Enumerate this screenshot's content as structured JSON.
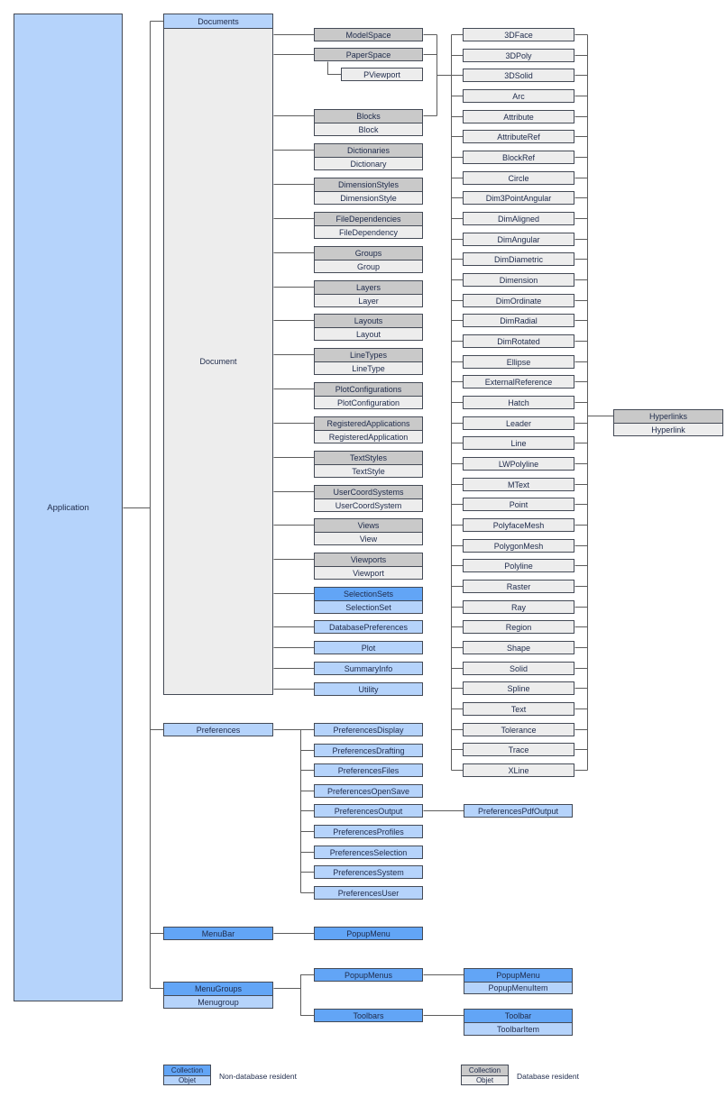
{
  "diagram": {
    "application": "Application",
    "documents": {
      "collection": "Documents",
      "object": "Document"
    },
    "model_space": "ModelSpace",
    "paper_space": "PaperSpace",
    "pviewport": "PViewport",
    "document_collections": [
      {
        "collection": "Blocks",
        "object": "Block",
        "resident": "database"
      },
      {
        "collection": "Dictionaries",
        "object": "Dictionary",
        "resident": "database"
      },
      {
        "collection": "DimensionStyles",
        "object": "DimensionStyle",
        "resident": "database"
      },
      {
        "collection": "FileDependencies",
        "object": "FileDependency",
        "resident": "database"
      },
      {
        "collection": "Groups",
        "object": "Group",
        "resident": "database"
      },
      {
        "collection": "Layers",
        "object": "Layer",
        "resident": "database"
      },
      {
        "collection": "Layouts",
        "object": "Layout",
        "resident": "database"
      },
      {
        "collection": "LineTypes",
        "object": "LineType",
        "resident": "database"
      },
      {
        "collection": "PlotConfigurations",
        "object": "PlotConfiguration",
        "resident": "database"
      },
      {
        "collection": "RegisteredApplications",
        "object": "RegisteredApplication",
        "resident": "database"
      },
      {
        "collection": "TextStyles",
        "object": "TextStyle",
        "resident": "database"
      },
      {
        "collection": "UserCoordSystems",
        "object": "UserCoordSystem",
        "resident": "database"
      },
      {
        "collection": "Views",
        "object": "View",
        "resident": "database"
      },
      {
        "collection": "Viewports",
        "object": "Viewport",
        "resident": "database"
      },
      {
        "collection": "SelectionSets",
        "object": "SelectionSet",
        "resident": "non-database"
      }
    ],
    "document_objects": [
      "DatabasePreferences",
      "Plot",
      "SummaryInfo",
      "Utility"
    ],
    "entities": [
      "3DFace",
      "3DPoly",
      "3DSolid",
      "Arc",
      "Attribute",
      "AttributeRef",
      "BlockRef",
      "Circle",
      "Dim3PointAngular",
      "DimAligned",
      "DimAngular",
      "DimDiametric",
      "Dimension",
      "DimOrdinate",
      "DimRadial",
      "DimRotated",
      "Ellipse",
      "ExternalReference",
      "Hatch",
      "Leader",
      "Line",
      "LWPolyline",
      "MText",
      "Point",
      "PolyfaceMesh",
      "PolygonMesh",
      "Polyline",
      "Raster",
      "Ray",
      "Region",
      "Shape",
      "Solid",
      "Spline",
      "Text",
      "Tolerance",
      "Trace",
      "XLine"
    ],
    "hyperlinks": {
      "collection": "Hyperlinks",
      "object": "Hyperlink"
    },
    "preferences": {
      "label": "Preferences",
      "children": [
        "PreferencesDisplay",
        "PreferencesDrafting",
        "PreferencesFiles",
        "PreferencesOpenSave",
        "PreferencesOutput",
        "PreferencesProfiles",
        "PreferencesSelection",
        "PreferencesSystem",
        "PreferencesUser"
      ],
      "pdf_output": "PreferencesPdfOutput"
    },
    "menubar": {
      "label": "MenuBar",
      "popup_menu": "PopupMenu"
    },
    "menugroups": {
      "collection": "MenuGroups",
      "object": "Menugroup",
      "popup_menus": "PopupMenus",
      "toolbars": "Toolbars",
      "popup_menu": {
        "collection": "PopupMenu",
        "object": "PopupMenuItem"
      },
      "toolbar": {
        "collection": "Toolbar",
        "object": "ToolbarItem"
      }
    }
  },
  "legend": [
    {
      "collection": "Collection",
      "object": "Objet",
      "description": "Non-database resident"
    },
    {
      "collection": "Collection",
      "object": "Objet",
      "description": "Database resident"
    }
  ],
  "colors": {
    "non_database_collection": "#62A5F6",
    "non_database_object": "#B5D3FB",
    "database_collection": "#C9C9C9",
    "database_object": "#EDEDED",
    "border": "#444A56",
    "connector": "#5C5C5C",
    "text": "#1E2A4A"
  }
}
